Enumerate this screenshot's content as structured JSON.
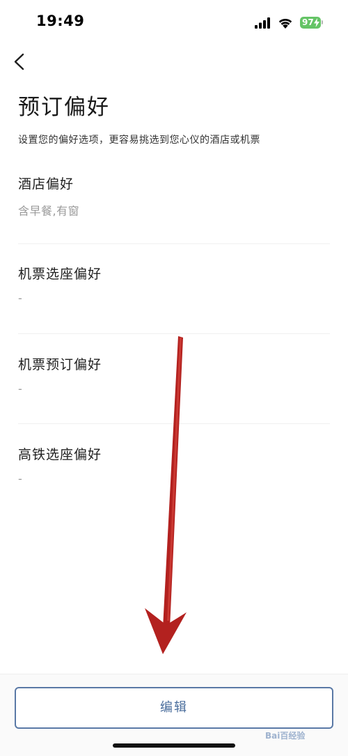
{
  "status_bar": {
    "time": "19:49",
    "battery_level": "97"
  },
  "header": {
    "title": "预订偏好",
    "subtitle": "设置您的偏好选项，更容易挑选到您心仪的酒店或机票"
  },
  "preferences": [
    {
      "name": "酒店偏好",
      "value": "含早餐,有窗"
    },
    {
      "name": "机票选座偏好",
      "value": "-"
    },
    {
      "name": "机票预订偏好",
      "value": "-"
    },
    {
      "name": "高铁选座偏好",
      "value": "-"
    }
  ],
  "footer": {
    "edit_label": "编辑"
  },
  "watermark": "Bai百经验",
  "colors": {
    "accent": "#4a6d9c",
    "battery": "#65c466",
    "annotation_arrow": "#b3211f"
  }
}
